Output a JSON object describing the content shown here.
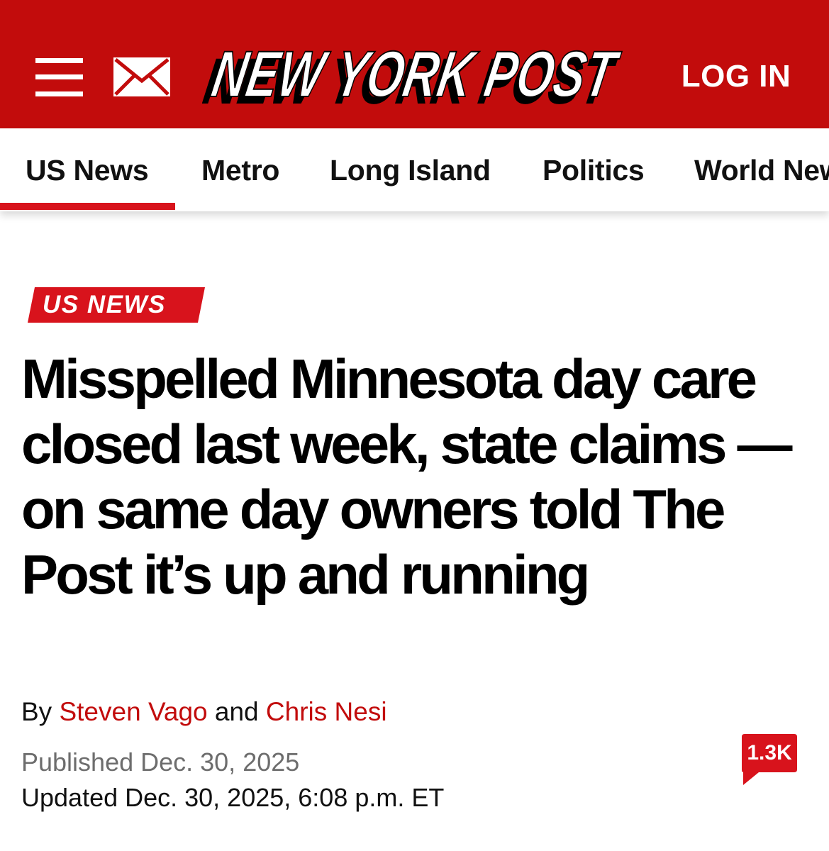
{
  "header": {
    "menu_icon": "hamburger-menu-icon",
    "mail_icon": "envelope-icon",
    "logo_text": "NEW YORK POST",
    "login_label": "LOG IN",
    "brand_color": "#c20c0c"
  },
  "nav": {
    "items": [
      {
        "label": "US News",
        "active": true
      },
      {
        "label": "Metro",
        "active": false
      },
      {
        "label": "Long Island",
        "active": false
      },
      {
        "label": "Politics",
        "active": false
      },
      {
        "label": "World News",
        "active": false
      }
    ],
    "active_underline_color": "#d8131c"
  },
  "article": {
    "section": "US NEWS",
    "headline": "Misspelled Minnesota day care closed last week, state claims — on same day owners told The Post it’s up and running",
    "byline": {
      "prefix": "By",
      "author1": "Steven Vago",
      "joiner": "and",
      "author2": "Chris Nesi"
    },
    "published": "Published Dec. 30, 2025",
    "updated": "Updated Dec. 30, 2025, 6:08 p.m. ET",
    "comment_count": "1.3K",
    "comment_icon": "comment-bubble-icon"
  }
}
